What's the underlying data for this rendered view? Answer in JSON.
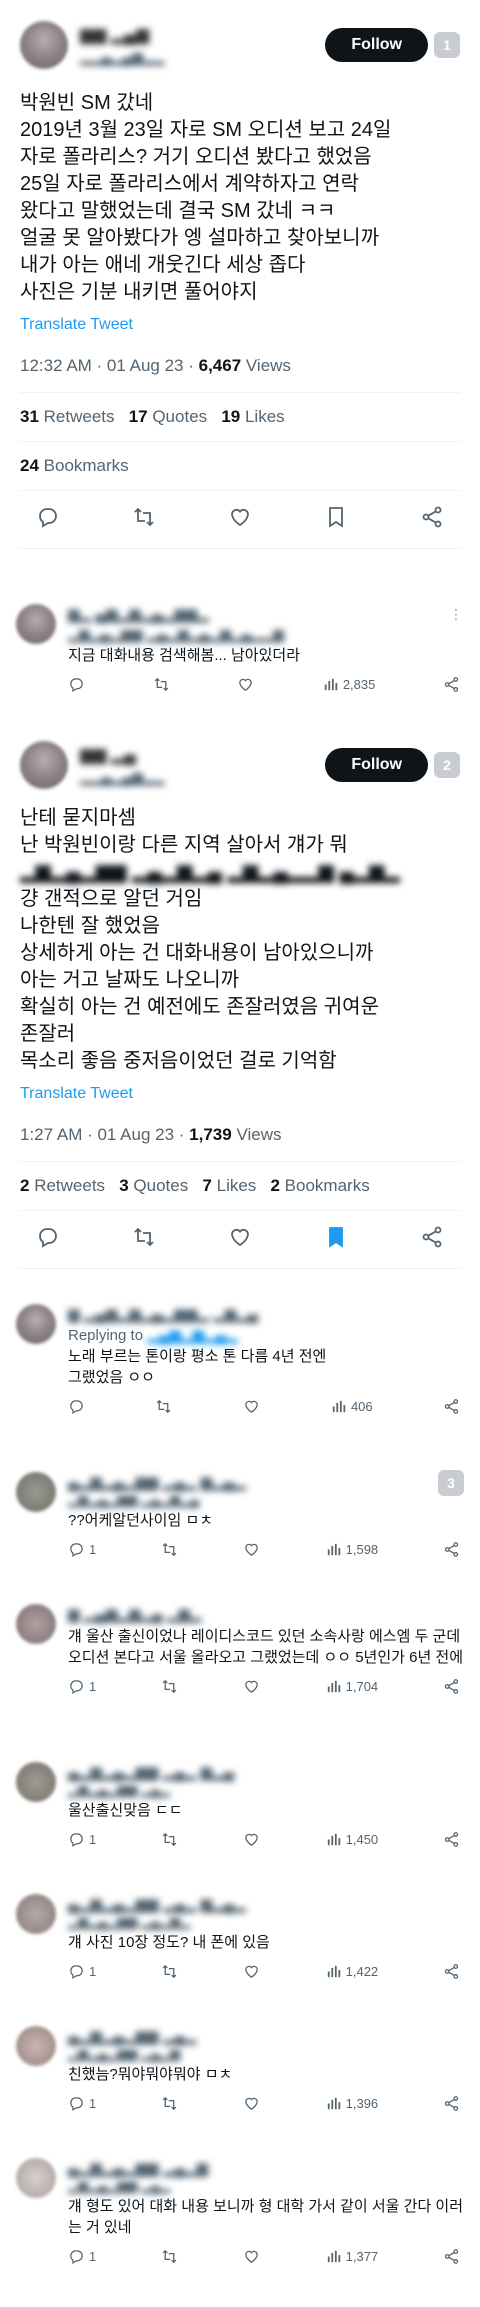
{
  "tweet1": {
    "follow_label": "Follow",
    "badge": "1",
    "lines": [
      "박원빈 SM 갔네",
      "2019년 3월 23일 자로 SM 오디션 보고 24일",
      "자로 폴라리스? 거기 오디션 봤다고 했었음",
      "25일 자로 폴라리스에서 계약하자고 연락",
      "왔다고 말했었는데 결국 SM 갔네 ㅋㅋ",
      "얼굴 못 알아봤다가 엥 설마하고 찾아보니까",
      "내가 아는 애네 개웃긴다 세상 좁다",
      "사진은 기분 내키면 풀어야지"
    ],
    "translate": "Translate Tweet",
    "time": "12:32 AM · 01 Aug 23 · ",
    "views_count": "6,467",
    "views_label": " Views",
    "retweets": "31",
    "retweets_label": " Retweets",
    "quotes": "17",
    "quotes_label": " Quotes",
    "likes": "19",
    "likes_label": " Likes",
    "bookmarks": "24",
    "bookmarks_label": " Bookmarks"
  },
  "reply1": {
    "text": "지금 대화내용 검색해봄... 남아있더라",
    "views": "2,835"
  },
  "tweet2": {
    "follow_label": "Follow",
    "badge": "2",
    "lines": [
      "난테 묻지마셈",
      "난 박원빈이랑 다른 지역 살아서 걔가 뭐"
    ],
    "lines_after": [
      "걍 갠적으로 알던 거임",
      "나한텐 잘 했었음",
      "상세하게 아는 건 대화내용이 남아있으니까",
      "아는 거고 날짜도 나오니까",
      "확실히 아는 건 예전에도 존잘러였음 귀여운",
      "존잘러",
      "목소리 좋음 중저음이었던 걸로 기억함"
    ],
    "translate": "Translate Tweet",
    "time": "1:27 AM · 01 Aug 23 · ",
    "views_count": "1,739",
    "views_label": " Views",
    "retweets": "2",
    "retweets_label": " Retweets",
    "quotes": "3",
    "quotes_label": " Quotes",
    "likes": "7",
    "likes_label": " Likes",
    "bookmarks": "2",
    "bookmarks_label": " Bookmarks"
  },
  "reply2": {
    "replying_to": "Replying to",
    "lines": [
      "노래 부르는 톤이랑 평소 톤 다름 4년 전엔",
      "그랬었음 ㅇㅇ"
    ],
    "views": "406"
  },
  "badge3": "3",
  "comments": [
    {
      "text": "??어케알던사이임 ㅁㅊ",
      "replies": "1",
      "views": "1,598"
    },
    {
      "text": "걔 울산 출신이었나 레이디스코드 있던 소속사랑 에스엠 두 군데 오디션 본다고 서울 올라오고 그랬었는데 ㅇㅇ 5년인가 6년 전에",
      "replies": "1",
      "views": "1,704"
    },
    {
      "text": "울산출신맞음 ㄷㄷ",
      "replies": "1",
      "views": "1,450"
    },
    {
      "text": "걔 사진 10장 정도? 내 폰에 있음",
      "replies": "1",
      "views": "1,422"
    },
    {
      "text": "친했늠?뭐야뭐야뭐야 ㅁㅊ",
      "replies": "1",
      "views": "1,396"
    },
    {
      "text": "걔 형도 있어 대화 내용 보니까 형 대학 가서 같이 서울 간다 이러는 거 있네",
      "replies": "1",
      "views": "1,377"
    }
  ]
}
